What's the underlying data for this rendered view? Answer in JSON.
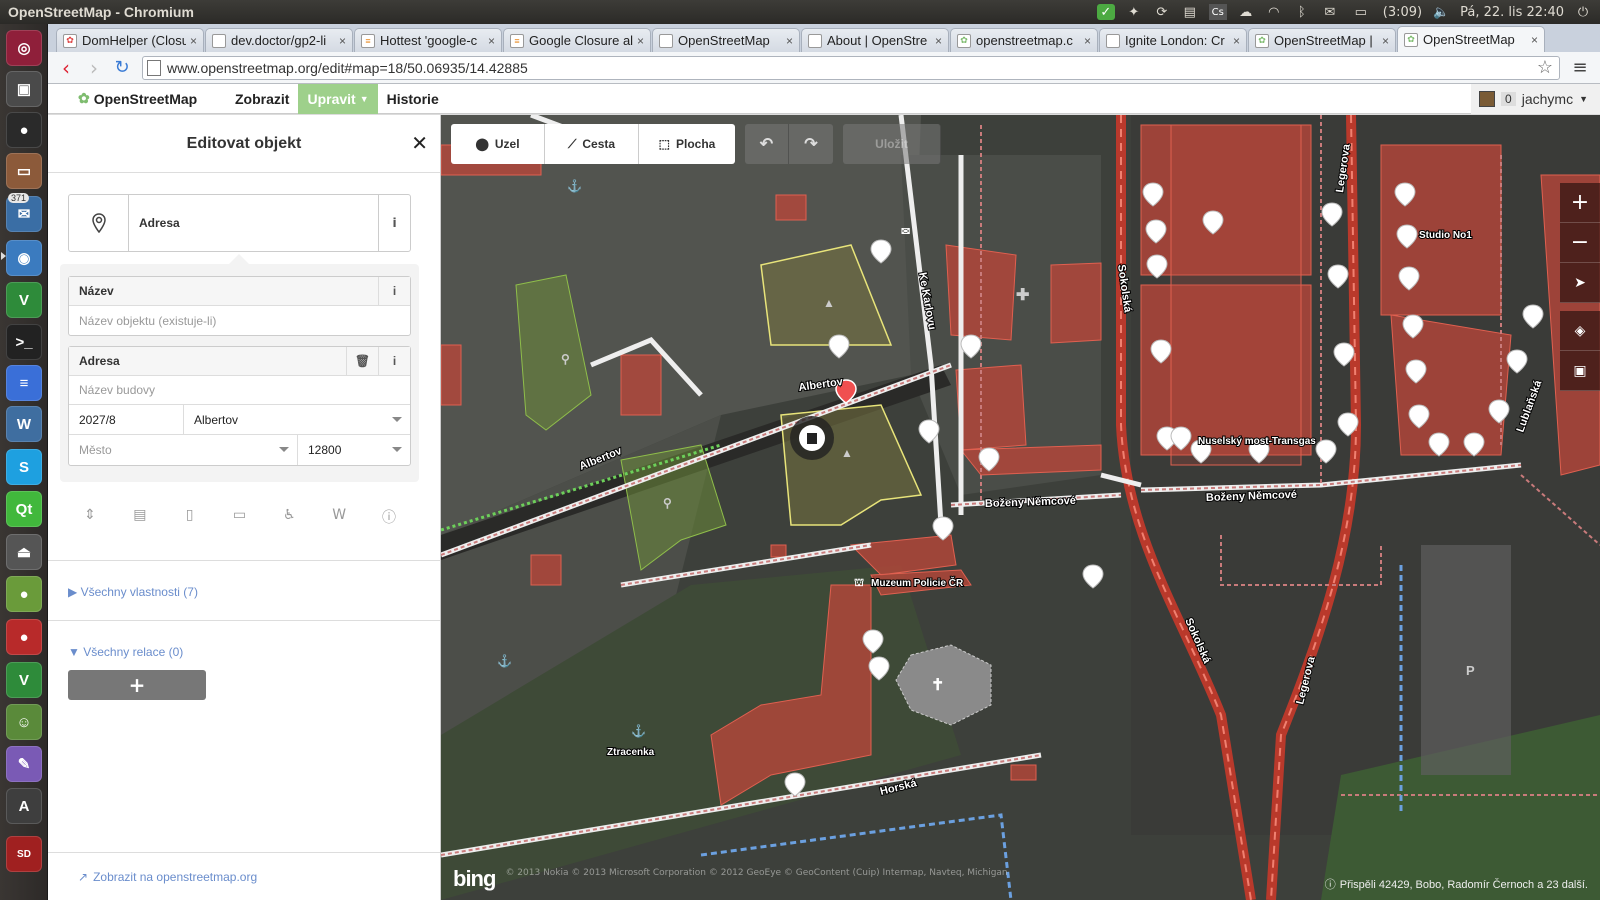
{
  "system": {
    "window_title": "OpenStreetMap - Chromium",
    "battery": "(3:09)",
    "clock": "Pá, 22. lis 22:40"
  },
  "launcher": {
    "badge_count": "371"
  },
  "browser": {
    "tabs": [
      {
        "label": "DomHelper (Closu",
        "active": false
      },
      {
        "label": "dev.doctor/gp2-li",
        "active": false
      },
      {
        "label": "Hottest 'google-c",
        "active": false
      },
      {
        "label": "Google Closure al",
        "active": false
      },
      {
        "label": "OpenStreetMap",
        "active": false
      },
      {
        "label": "About | OpenStre",
        "active": false
      },
      {
        "label": "openstreetmap.c",
        "active": false
      },
      {
        "label": "Ignite London: Cr",
        "active": false
      },
      {
        "label": "OpenStreetMap |",
        "active": false
      },
      {
        "label": "OpenStreetMap",
        "active": true
      }
    ],
    "close_glyph": "×",
    "url": "www.openstreetmap.org/edit#map=18/50.06935/14.42885"
  },
  "osm": {
    "brand": "OpenStreetMap",
    "nav": [
      "Zobrazit",
      "Upravit",
      "Historie"
    ],
    "user_count": "0",
    "username": "jachymc"
  },
  "editor": {
    "title": "Editovat objekt",
    "preset_label": "Adresa",
    "name_field": {
      "label": "Název",
      "placeholder": "Název objektu (existuje-li)"
    },
    "address_field": {
      "label": "Adresa",
      "building_placeholder": "Název budovy",
      "housenumber": "2027/8",
      "street": "Albertov",
      "city_placeholder": "Město",
      "postcode": "12800"
    },
    "all_tags": "Všechny vlastnosti (7)",
    "all_relations": "Všechny relace (0)",
    "add_relation": "+",
    "view_link": "Zobrazit na openstreetmap.org"
  },
  "map_toolbar": {
    "node": "Uzel",
    "way": "Cesta",
    "area": "Plocha",
    "save": "Uložit"
  },
  "map_labels": {
    "ke_karlovu": "Ke Karlovu",
    "albertov_1": "Albertov",
    "albertov_2": "Albertov",
    "sokolska_1": "Sokolská",
    "sokolska_2": "Sokolská",
    "legerova_1": "Legerova",
    "legerova_2": "Legerova",
    "bozeny_1": "Boženy Němcové",
    "bozeny_2": "Boženy Němcové",
    "muzeum": "Muzeum Policie ČR",
    "nuselsky": "Nuselský most-Transgas",
    "studio": "Studio No1",
    "lublanska": "Lublaňská",
    "ztracenka": "Ztracenka",
    "horska": "Horská"
  },
  "attribution": {
    "logo": "bing",
    "credits": "© 2013 Nokia © 2013 Microsoft Corporation © 2012 GeoEye © GeoContent (Cuip) Intermap, Navteq, Michigan",
    "contributors": "Přispěli 42429, Bobo, Radomír Černoch a 23 další."
  },
  "colors": {
    "edit_tab": "#9ed08b",
    "link": "#6a8dcc",
    "building": "#d9574a",
    "selected": "#e8e47a"
  }
}
